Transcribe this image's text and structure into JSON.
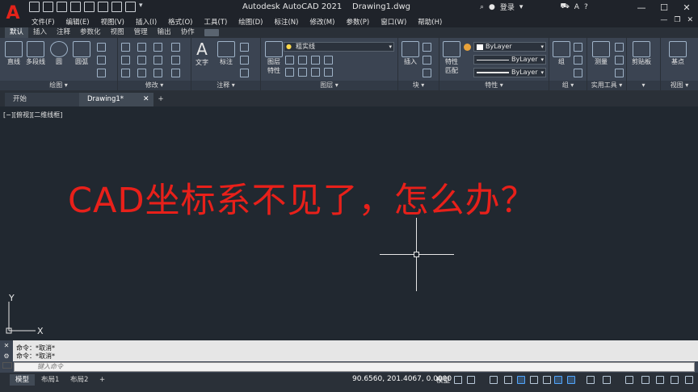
{
  "app": {
    "logo_letter": "A",
    "title": "Autodesk AutoCAD 2021",
    "filename": "Drawing1.dwg",
    "login": "登录"
  },
  "menu": [
    "文件(F)",
    "编辑(E)",
    "视图(V)",
    "插入(I)",
    "格式(O)",
    "工具(T)",
    "绘图(D)",
    "标注(N)",
    "修改(M)",
    "参数(P)",
    "窗口(W)",
    "帮助(H)"
  ],
  "ribbon_tabs": [
    "默认",
    "插入",
    "注释",
    "参数化",
    "视图",
    "管理",
    "输出",
    "协作"
  ],
  "ribbon": {
    "draw": {
      "line": "直线",
      "polyline": "多段线",
      "circle": "圆",
      "arc": "圆弧",
      "panel": "绘图"
    },
    "modify": {
      "panel": "修改"
    },
    "annotation": {
      "text": "文字",
      "dimension": "标注",
      "panel": "注释"
    },
    "layers": {
      "layer_props_1": "图层",
      "layer_props_2": "特性",
      "layer_combo": "粗实线",
      "panel": "图层"
    },
    "block": {
      "insert": "插入",
      "panel": "块"
    },
    "properties": {
      "match_1": "特性",
      "match_2": "匹配",
      "color": "ByLayer",
      "linetype": "ByLayer",
      "lineweight": "ByLayer",
      "panel": "特性"
    },
    "groups": {
      "group": "组",
      "panel": "组"
    },
    "utilities": {
      "measure": "测量",
      "panel": "实用工具"
    },
    "clipboard": {
      "paste": "剪贴板"
    },
    "view": {
      "base": "基点",
      "panel": "视图"
    }
  },
  "doc_tabs": {
    "home": "开始",
    "drawing": "Drawing1*"
  },
  "canvas": {
    "view_label": "[−][俯视][二维线框]",
    "headline": "CAD坐标系不见了，怎么办？",
    "headline_color": "#e8201a",
    "ucs_y": "Y",
    "ucs_x": "X"
  },
  "command": {
    "history": [
      "命令：*取消*",
      "命令：*取消*"
    ],
    "placeholder": "键入命令"
  },
  "status": {
    "layouts": [
      "模型",
      "布局1",
      "布局2"
    ],
    "coordinates": "90.6560, 201.4067, 0.0000",
    "space": "模型"
  }
}
